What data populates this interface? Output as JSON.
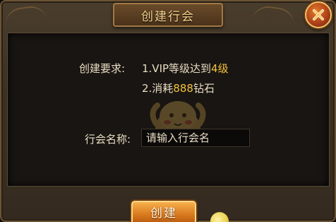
{
  "dialog": {
    "title": "创建行会",
    "close_icon": "close-x-icon",
    "accent_color": "#f5c23a"
  },
  "requirements": {
    "label": "创建要求:",
    "line1": {
      "prefix": "1.VIP等级达到",
      "value": "4",
      "suffix": "级"
    },
    "line2": {
      "prefix": "2.消耗",
      "value": "888",
      "suffix": "钻石"
    }
  },
  "guild_name": {
    "label": "行会名称:",
    "placeholder": "请输入行会名",
    "value": ""
  },
  "actions": {
    "create_label": "创建"
  },
  "decor": {
    "watermark_icon": "mascot-watermark-icon"
  }
}
